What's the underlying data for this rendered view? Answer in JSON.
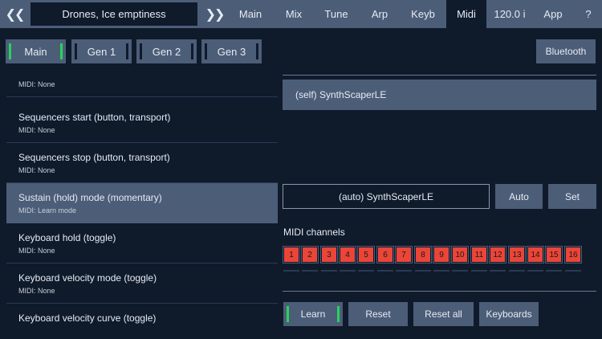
{
  "topbar": {
    "prev_icon": "chevrons-left-icon",
    "prev_glyph": "❮❮",
    "preset_name": "Drones, Ice emptiness",
    "next_icon": "chevrons-right-icon",
    "next_glyph": "❯❯",
    "tabs": [
      {
        "label": "Main"
      },
      {
        "label": "Mix"
      },
      {
        "label": "Tune"
      },
      {
        "label": "Arp"
      },
      {
        "label": "Keyb"
      },
      {
        "label": "Midi"
      },
      {
        "label": "120.0 i"
      },
      {
        "label": "App"
      },
      {
        "label": "?"
      }
    ],
    "active_tab": "Midi"
  },
  "gen_buttons": [
    {
      "label": "Main",
      "active": true
    },
    {
      "label": "Gen 1",
      "active": false
    },
    {
      "label": "Gen 2",
      "active": false
    },
    {
      "label": "Gen 3",
      "active": false
    }
  ],
  "bluetooth_label": "Bluetooth",
  "midi_list": [
    {
      "title": "",
      "sub": "MIDI: None",
      "selected": false
    },
    {
      "title": "Sequencers start (button, transport)",
      "sub": "MIDI: None",
      "selected": false
    },
    {
      "title": "Sequencers stop (button, transport)",
      "sub": "MIDI: None",
      "selected": false
    },
    {
      "title": "Sustain (hold) mode (momentary)",
      "sub": "MIDI: Learn mode",
      "selected": true
    },
    {
      "title": "Keyboard hold (toggle)",
      "sub": "MIDI: None",
      "selected": false
    },
    {
      "title": "Keyboard velocity mode (toggle)",
      "sub": "MIDI: None",
      "selected": false
    },
    {
      "title": "Keyboard velocity curve (toggle)",
      "sub": "",
      "selected": false
    }
  ],
  "device_row": "(self) SynthScaperLE",
  "auto_field": "(auto) SynthScaperLE",
  "auto_button": "Auto",
  "set_button": "Set",
  "channels_label": "MIDI channels",
  "channels": [
    "1",
    "2",
    "3",
    "4",
    "5",
    "6",
    "7",
    "8",
    "9",
    "10",
    "11",
    "12",
    "13",
    "14",
    "15",
    "16"
  ],
  "colors": {
    "accent_green": "#28d25a",
    "channel_red": "#ea4538",
    "panel": "#4c5d78",
    "background": "#0f1a2b"
  },
  "bottom_buttons": {
    "learn": "Learn",
    "reset": "Reset",
    "reset_all": "Reset all",
    "keyboards": "Keyboards"
  }
}
